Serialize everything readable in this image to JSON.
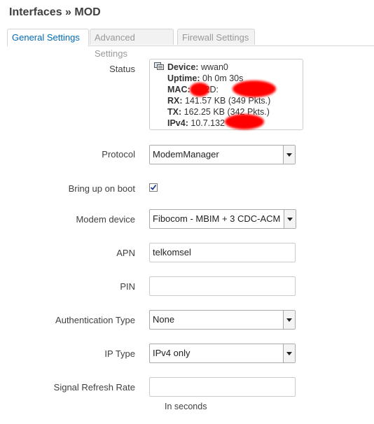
{
  "page": {
    "title": "Interfaces » MOD"
  },
  "tabs": [
    {
      "label": "General Settings",
      "active": true
    },
    {
      "label": "Advanced Settings",
      "active": false
    },
    {
      "label": "Firewall Settings",
      "active": false
    }
  ],
  "status": {
    "label": "Status",
    "device_label": "Device:",
    "device_value": "wwan0",
    "uptime_label": "Uptime:",
    "uptime_value": "0h 0m 30s",
    "mac_label": "MAC:",
    "mac_value": "34:2D:",
    "rx_label": "RX:",
    "rx_value": "141.57 KB (349 Pkts.)",
    "tx_label": "TX:",
    "tx_value": "162.25 KB (342 Pkts.)",
    "ipv4_label": "IPv4:",
    "ipv4_value": "10.7.132"
  },
  "form": {
    "protocol": {
      "label": "Protocol",
      "value": "ModemManager"
    },
    "bring_up": {
      "label": "Bring up on boot",
      "checked": true
    },
    "modem_device": {
      "label": "Modem device",
      "value": "Fibocom - MBIM + 3 CDC-ACM"
    },
    "apn": {
      "label": "APN",
      "value": "telkomsel"
    },
    "pin": {
      "label": "PIN",
      "value": ""
    },
    "auth_type": {
      "label": "Authentication Type",
      "value": "None"
    },
    "ip_type": {
      "label": "IP Type",
      "value": "IPv4 only"
    },
    "signal_refresh": {
      "label": "Signal Refresh Rate",
      "value": "",
      "hint": "In seconds"
    }
  },
  "colors": {
    "accent": "#0069b4",
    "redaction": "#ff0000"
  }
}
